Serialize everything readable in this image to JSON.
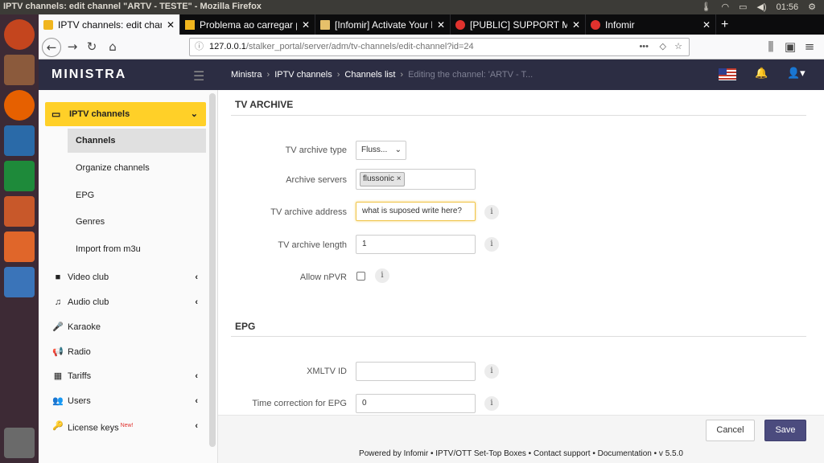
{
  "window": {
    "title": "IPTV channels: edit channel \"ARTV - TESTE\" - Mozilla Firefox",
    "clock": "01:56"
  },
  "tabs": [
    {
      "label": "IPTV channels: edit chann",
      "active": true
    },
    {
      "label": "Problema ao carregar pá",
      "active": false
    },
    {
      "label": "[Infomir] Activate Your M",
      "active": false
    },
    {
      "label": "[PUBLIC] SUPPORT MAIN",
      "active": false
    },
    {
      "label": "Infomir",
      "active": false
    }
  ],
  "browser": {
    "url_host": "127.0.0.1",
    "url_path": "/stalker_portal/server/adm/tv-channels/edit-channel?id=24"
  },
  "app": {
    "logo": "MINISTRA",
    "breadcrumbs": [
      "Ministra",
      "IPTV channels",
      "Channels list",
      "Editing the channel: 'ARTV - T..."
    ]
  },
  "sidebar": {
    "active_section": "IPTV channels",
    "subitems": [
      "Channels",
      "Organize channels",
      "EPG",
      "Genres",
      "Import from m3u"
    ],
    "items": [
      {
        "label": "Video club",
        "icon": "video-camera-icon",
        "chevron": true
      },
      {
        "label": "Audio club",
        "icon": "music-note-icon",
        "chevron": true
      },
      {
        "label": "Karaoke",
        "icon": "microphone-icon",
        "chevron": false
      },
      {
        "label": "Radio",
        "icon": "bullhorn-icon",
        "chevron": false
      },
      {
        "label": "Tariffs",
        "icon": "calculator-icon",
        "chevron": true
      },
      {
        "label": "Users",
        "icon": "users-icon",
        "chevron": true
      },
      {
        "label": "License keys",
        "icon": "key-icon",
        "chevron": true,
        "badge": "New!"
      }
    ]
  },
  "archive": {
    "title": "TV ARCHIVE",
    "type_label": "TV archive type",
    "type_value": "Fluss...",
    "servers_label": "Archive servers",
    "servers_tag": "flussonic",
    "address_label": "TV archive address",
    "address_value": "what is suposed write here?",
    "length_label": "TV archive length",
    "length_value": "1",
    "npvr_label": "Allow nPVR"
  },
  "epg": {
    "title": "EPG",
    "xmltv_label": "XMLTV ID",
    "xmltv_value": "",
    "correction_label": "Time correction for EPG",
    "correction_value": "0"
  },
  "actions": {
    "cancel": "Cancel",
    "save": "Save"
  },
  "footer": "Powered by Infomir • IPTV/OTT Set-Top Boxes • Contact support • Documentation • v 5.5.0",
  "colors": {
    "header": "#2c2d43",
    "active_menu": "#ffd028",
    "save": "#4b4b7e"
  }
}
